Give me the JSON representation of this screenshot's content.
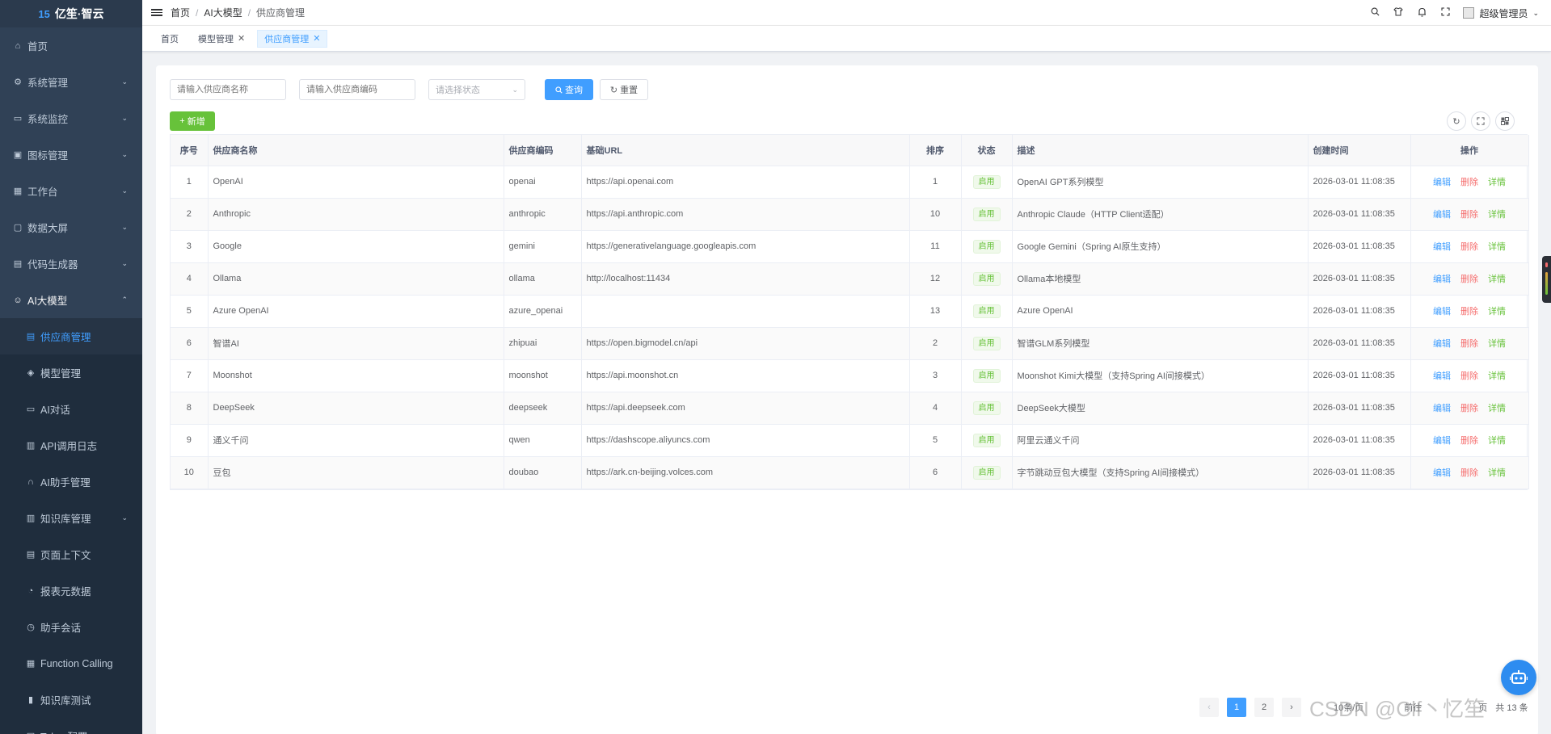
{
  "app": {
    "logo_mark": "15",
    "logo_text": "亿笙·智云"
  },
  "sidebar": {
    "items": [
      {
        "label": "首页",
        "icon": "home-icon"
      },
      {
        "label": "系统管理",
        "icon": "gear-icon"
      },
      {
        "label": "系统监控",
        "icon": "monitor-icon"
      },
      {
        "label": "图标管理",
        "icon": "image-icon"
      },
      {
        "label": "工作台",
        "icon": "dashboard-icon"
      },
      {
        "label": "数据大屏",
        "icon": "screen-icon"
      },
      {
        "label": "代码生成器",
        "icon": "code-icon"
      },
      {
        "label": "AI大模型",
        "icon": "robot-icon"
      },
      {
        "label": "供应商管理",
        "icon": "list-icon"
      },
      {
        "label": "模型管理",
        "icon": "cube-icon"
      },
      {
        "label": "AI对话",
        "icon": "chat-icon"
      },
      {
        "label": "API调用日志",
        "icon": "log-icon"
      },
      {
        "label": "AI助手管理",
        "icon": "headset-icon"
      },
      {
        "label": "知识库管理",
        "icon": "book-icon"
      },
      {
        "label": "页面上下文",
        "icon": "page-icon"
      },
      {
        "label": "报表元数据",
        "icon": "report-icon"
      },
      {
        "label": "助手会话",
        "icon": "session-icon"
      },
      {
        "label": "Function Calling",
        "icon": "function-icon"
      },
      {
        "label": "知识库测试",
        "icon": "test-icon"
      },
      {
        "label": "Token配置",
        "icon": "token-icon"
      }
    ]
  },
  "topbar": {
    "breadcrumb": [
      "首页",
      "AI大模型",
      "供应商管理"
    ],
    "username": "超级管理员"
  },
  "tags": [
    "首页",
    "模型管理",
    "供应商管理"
  ],
  "filters": {
    "name_placeholder": "请输入供应商名称",
    "code_placeholder": "请输入供应商编码",
    "status_placeholder": "请选择状态",
    "search_label": "查询",
    "reset_label": "重置",
    "add_label": "新增"
  },
  "table": {
    "headers": [
      "序号",
      "供应商名称",
      "供应商编码",
      "基础URL",
      "排序",
      "状态",
      "描述",
      "创建时间",
      "操作"
    ],
    "ops": {
      "edit": "编辑",
      "delete": "删除",
      "detail": "详情"
    },
    "rows": [
      {
        "idx": "1",
        "name": "OpenAI",
        "code": "openai",
        "url": "https://api.openai.com",
        "sort": "1",
        "status": "启用",
        "desc": "OpenAI GPT系列模型",
        "created": "2026-03-01 11:08:35"
      },
      {
        "idx": "2",
        "name": "Anthropic",
        "code": "anthropic",
        "url": "https://api.anthropic.com",
        "sort": "10",
        "status": "启用",
        "desc": "Anthropic Claude（HTTP Client适配）",
        "created": "2026-03-01 11:08:35"
      },
      {
        "idx": "3",
        "name": "Google",
        "code": "gemini",
        "url": "https://generativelanguage.googleapis.com",
        "sort": "11",
        "status": "启用",
        "desc": "Google Gemini（Spring AI原生支持）",
        "created": "2026-03-01 11:08:35"
      },
      {
        "idx": "4",
        "name": "Ollama",
        "code": "ollama",
        "url": "http://localhost:11434",
        "sort": "12",
        "status": "启用",
        "desc": "Ollama本地模型",
        "created": "2026-03-01 11:08:35"
      },
      {
        "idx": "5",
        "name": "Azure OpenAI",
        "code": "azure_openai",
        "url": "",
        "sort": "13",
        "status": "启用",
        "desc": "Azure OpenAI",
        "created": "2026-03-01 11:08:35"
      },
      {
        "idx": "6",
        "name": "智谱AI",
        "code": "zhipuai",
        "url": "https://open.bigmodel.cn/api",
        "sort": "2",
        "status": "启用",
        "desc": "智谱GLM系列模型",
        "created": "2026-03-01 11:08:35"
      },
      {
        "idx": "7",
        "name": "Moonshot",
        "code": "moonshot",
        "url": "https://api.moonshot.cn",
        "sort": "3",
        "status": "启用",
        "desc": "Moonshot Kimi大模型（支持Spring AI间接模式）",
        "created": "2026-03-01 11:08:35"
      },
      {
        "idx": "8",
        "name": "DeepSeek",
        "code": "deepseek",
        "url": "https://api.deepseek.com",
        "sort": "4",
        "status": "启用",
        "desc": "DeepSeek大模型",
        "created": "2026-03-01 11:08:35"
      },
      {
        "idx": "9",
        "name": "通义千问",
        "code": "qwen",
        "url": "https://dashscope.aliyuncs.com",
        "sort": "5",
        "status": "启用",
        "desc": "阿里云通义千问",
        "created": "2026-03-01 11:08:35"
      },
      {
        "idx": "10",
        "name": "豆包",
        "code": "doubao",
        "url": "https://ark.cn-beijing.volces.com",
        "sort": "6",
        "status": "启用",
        "desc": "字节跳动豆包大模型（支持Spring AI间接模式）",
        "created": "2026-03-01 11:08:35"
      }
    ]
  },
  "pagination": {
    "pages": [
      "1",
      "2"
    ],
    "current": "1",
    "page_size": "10条/页",
    "goto_label": "前往",
    "page_unit": "页",
    "total": "共 13 条"
  },
  "watermark": "CSDN @Clf丶忆笙",
  "colors": {
    "primary": "#409eff",
    "success": "#67c23a",
    "danger": "#f56c6c",
    "sidebar": "#304156"
  }
}
